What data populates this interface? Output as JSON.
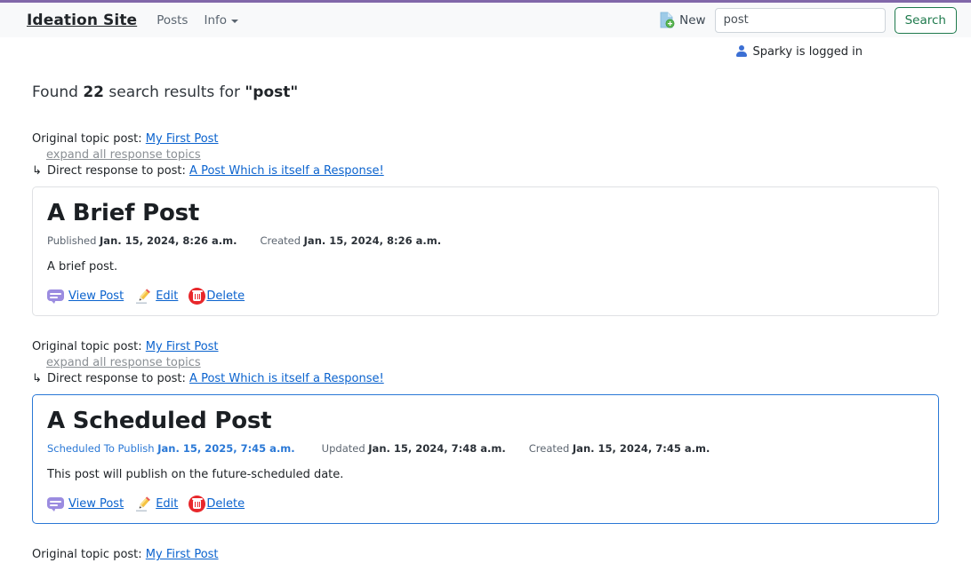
{
  "navbar": {
    "brand": "Ideation Site",
    "links": [
      {
        "label": "Posts",
        "name": "nav-link-posts"
      },
      {
        "label": "Info",
        "name": "nav-link-info",
        "dropdown": true
      }
    ],
    "new_label": "New",
    "new_icon": "new-document-icon",
    "search": {
      "value": "post",
      "placeholder": "",
      "button_label": "Search"
    },
    "colors": {
      "top_border": "#8167a9",
      "navbar_bg": "#f8f9fa",
      "search_button_accent": "#1f7a4d"
    }
  },
  "account": {
    "status_text": "Sparky is logged in",
    "icon": "person-icon",
    "icon_color": "#3b6fd4"
  },
  "main": {
    "found_prefix": "Found ",
    "found_count": "22",
    "found_middle": " search results for ",
    "found_query": "\"post\"",
    "results": [
      {
        "original_label": "Original topic post: ",
        "original_link": "My First Post",
        "expand_label": "expand all response topics",
        "response_arrow": "↳",
        "response_label": " Direct response to post: ",
        "response_link": "A Post Which is itself a Response!",
        "card": {
          "title": "A Brief Post",
          "scheduled": false,
          "meta": [
            {
              "label": "Published ",
              "value": "Jan. 15, 2024, 8:26 a.m.",
              "kind": "normal"
            },
            {
              "label": "Created ",
              "value": "Jan. 15, 2024, 8:26 a.m.",
              "kind": "normal"
            }
          ],
          "body": "A brief post.",
          "actions": [
            {
              "icon": "speech-bubble-icon",
              "label": "View Post"
            },
            {
              "icon": "pencil-icon",
              "label": "Edit"
            },
            {
              "icon": "trash-icon",
              "label": "Delete"
            }
          ]
        }
      },
      {
        "original_label": "Original topic post: ",
        "original_link": "My First Post",
        "expand_label": "expand all response topics",
        "response_arrow": "↳",
        "response_label": " Direct response to post: ",
        "response_link": "A Post Which is itself a Response!",
        "card": {
          "title": "A Scheduled Post",
          "scheduled": true,
          "meta": [
            {
              "label": "Scheduled To Publish ",
              "value": "Jan. 15, 2025, 7:45 a.m.",
              "kind": "scheduled"
            },
            {
              "label": "Updated ",
              "value": "Jan. 15, 2024, 7:48 a.m.",
              "kind": "normal"
            },
            {
              "label": "Created ",
              "value": "Jan. 15, 2024, 7:45 a.m.",
              "kind": "normal"
            }
          ],
          "body": "This post will publish on the future-scheduled date.",
          "actions": [
            {
              "icon": "speech-bubble-icon",
              "label": "View Post"
            },
            {
              "icon": "pencil-icon",
              "label": "Edit"
            },
            {
              "icon": "trash-icon",
              "label": "Delete"
            }
          ]
        }
      },
      {
        "original_label": "Original topic post: ",
        "original_link": "My First Post",
        "truncated": true
      }
    ],
    "colors": {
      "link": "#0b63ce",
      "muted_link": "#8a8f94",
      "scheduled_accent": "#2a78d6",
      "card_border": "#dfe1e4"
    }
  }
}
